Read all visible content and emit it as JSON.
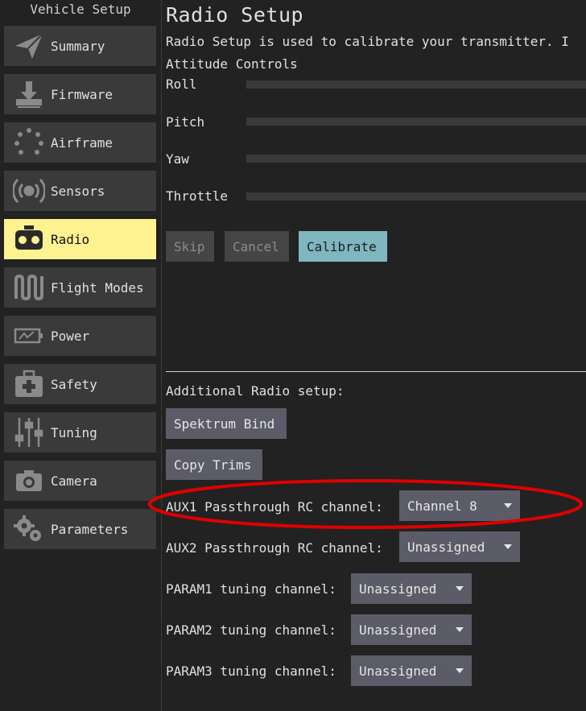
{
  "sidebar": {
    "title": "Vehicle Setup",
    "items": [
      {
        "label": "Summary",
        "icon": "paper-plane-icon"
      },
      {
        "label": "Firmware",
        "icon": "download-icon"
      },
      {
        "label": "Airframe",
        "icon": "airframe-dots-icon"
      },
      {
        "label": "Sensors",
        "icon": "radio-waves-icon"
      },
      {
        "label": "Radio",
        "icon": "radio-icon",
        "active": true
      },
      {
        "label": "Flight Modes",
        "icon": "flight-modes-icon"
      },
      {
        "label": "Power",
        "icon": "battery-icon"
      },
      {
        "label": "Safety",
        "icon": "first-aid-kit-icon"
      },
      {
        "label": "Tuning",
        "icon": "sliders-icon"
      },
      {
        "label": "Camera",
        "icon": "camera-icon"
      },
      {
        "label": "Parameters",
        "icon": "gears-icon"
      }
    ]
  },
  "main": {
    "title": "Radio Setup",
    "description": "Radio Setup is used to calibrate your transmitter. I",
    "attitude_title": "Attitude Controls",
    "axes": [
      "Roll",
      "Pitch",
      "Yaw",
      "Throttle"
    ],
    "buttons": {
      "skip": "Skip",
      "cancel": "Cancel",
      "calibrate": "Calibrate"
    },
    "additional_title": "Additional Radio setup:",
    "spektrum_bind": "Spektrum Bind",
    "copy_trims": "Copy Trims",
    "rows": [
      {
        "label": "AUX1 Passthrough RC channel:",
        "value": "Channel 8"
      },
      {
        "label": "AUX2 Passthrough RC channel:",
        "value": "Unassigned"
      },
      {
        "label": "PARAM1 tuning channel:",
        "value": "Unassigned"
      },
      {
        "label": "PARAM2 tuning channel:",
        "value": "Unassigned"
      },
      {
        "label": "PARAM3 tuning channel:",
        "value": "Unassigned"
      }
    ]
  },
  "colors": {
    "background": "#222222",
    "nav_button": "#3a3a3a",
    "nav_active": "#fff291",
    "control": "#5c5c68",
    "primary": "#7fb7c0",
    "highlight": "#e00000"
  }
}
